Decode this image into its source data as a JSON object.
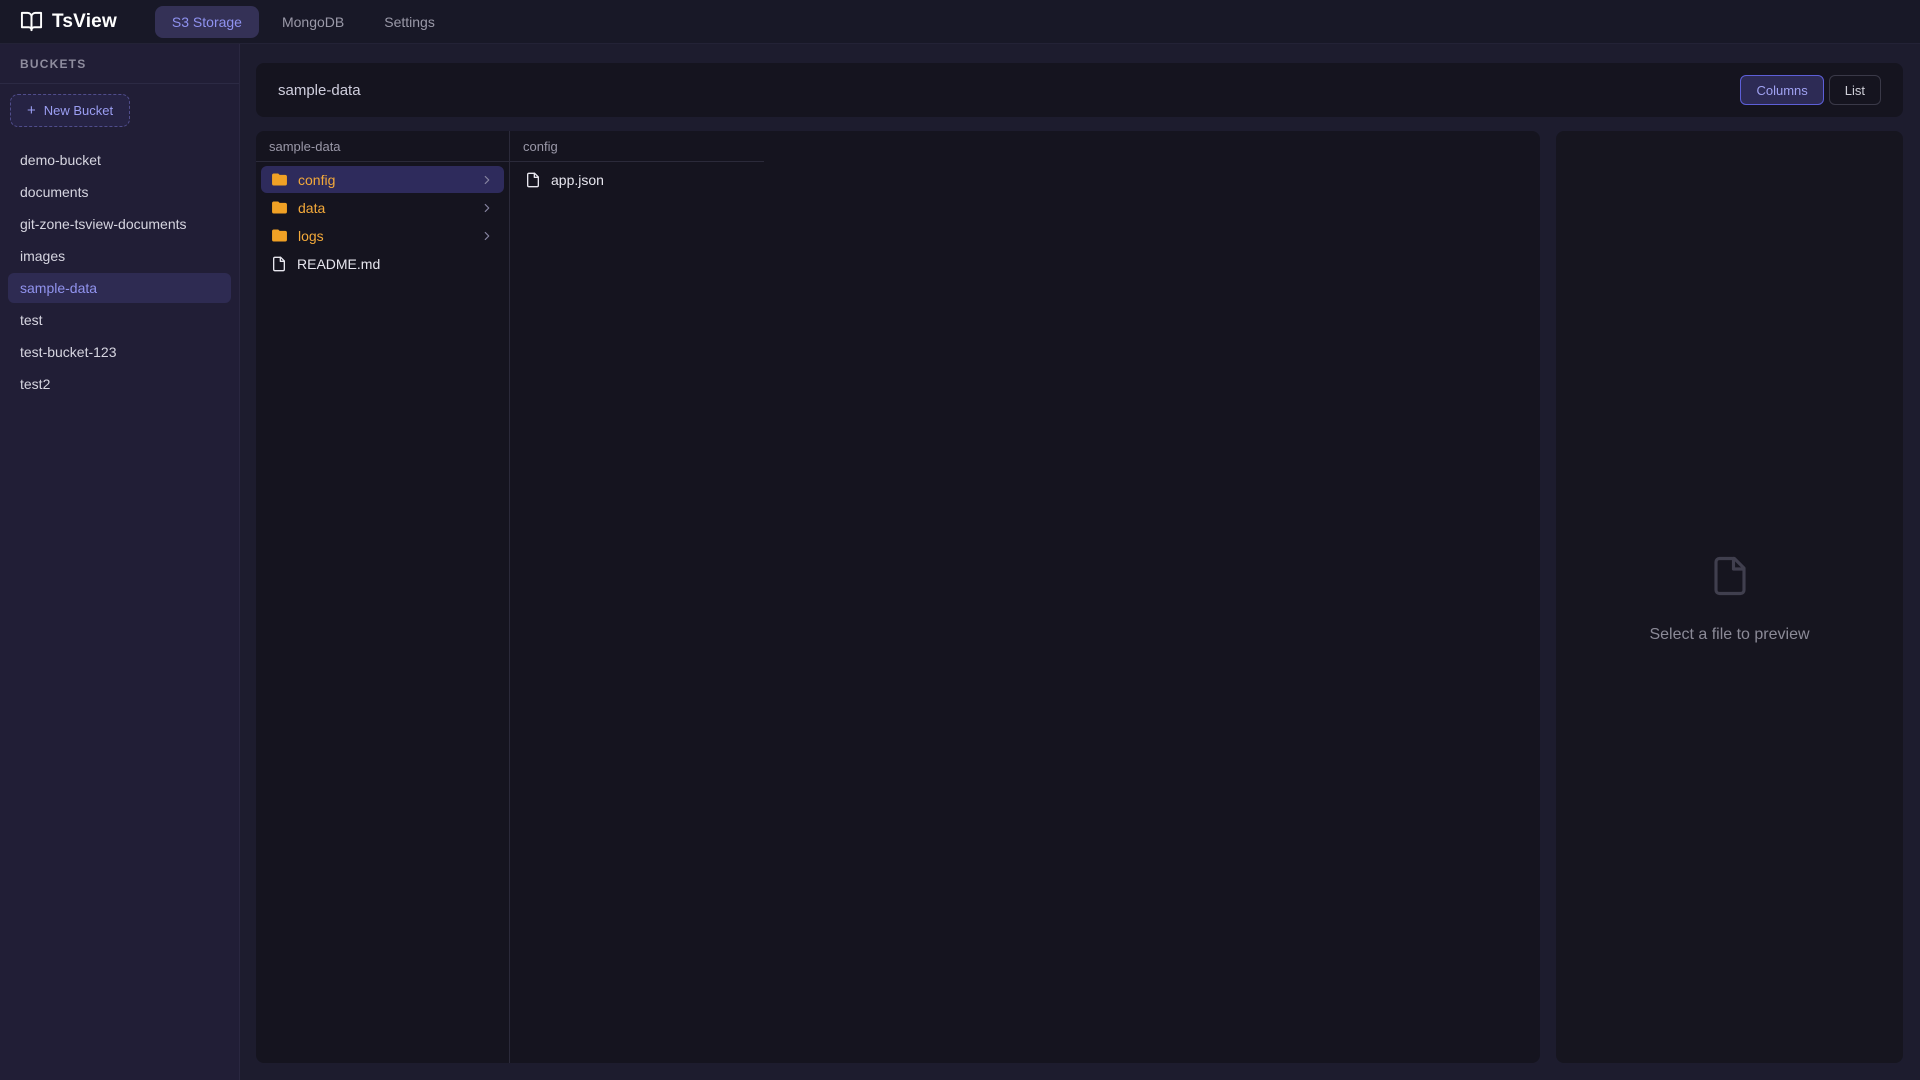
{
  "app": {
    "title": "TsView"
  },
  "navbar": {
    "tabs": [
      {
        "label": "S3 Storage",
        "active": true
      },
      {
        "label": "MongoDB",
        "active": false
      },
      {
        "label": "Settings",
        "active": false
      }
    ]
  },
  "sidebar": {
    "section_label": "BUCKETS",
    "new_bucket": {
      "icon": "plus-icon",
      "label": "New Bucket"
    },
    "buckets": [
      "demo-bucket",
      "documents",
      "git-zone-tsview-documents",
      "images",
      "sample-data",
      "test",
      "test-bucket-123",
      "test2"
    ],
    "selected_bucket": "sample-data"
  },
  "header": {
    "title": "sample-data",
    "view_buttons": [
      {
        "label": "Columns",
        "active": true
      },
      {
        "label": "List",
        "active": false
      }
    ]
  },
  "columns": [
    {
      "header": "sample-data",
      "items": [
        {
          "name": "config",
          "type": "folder",
          "selected": true
        },
        {
          "name": "data",
          "type": "folder",
          "selected": false
        },
        {
          "name": "logs",
          "type": "folder",
          "selected": false
        },
        {
          "name": "README.md",
          "type": "file",
          "selected": false
        }
      ]
    },
    {
      "header": "config",
      "items": [
        {
          "name": "app.json",
          "type": "file",
          "selected": false
        }
      ]
    }
  ],
  "preview": {
    "placeholder": "Select a file to preview"
  },
  "colors": {
    "accent_indigo": "#6366f1",
    "accent_indigo_text": "#9193ee",
    "folder_amber": "#f0a125",
    "panel_bg": "#15141f",
    "sidebar_bg": "#211e36",
    "navbar_bg": "#181827",
    "main_bg": "#1d1c2e",
    "selected_row_bg": "#2e2b5c",
    "muted_text": "#9a98a8"
  }
}
